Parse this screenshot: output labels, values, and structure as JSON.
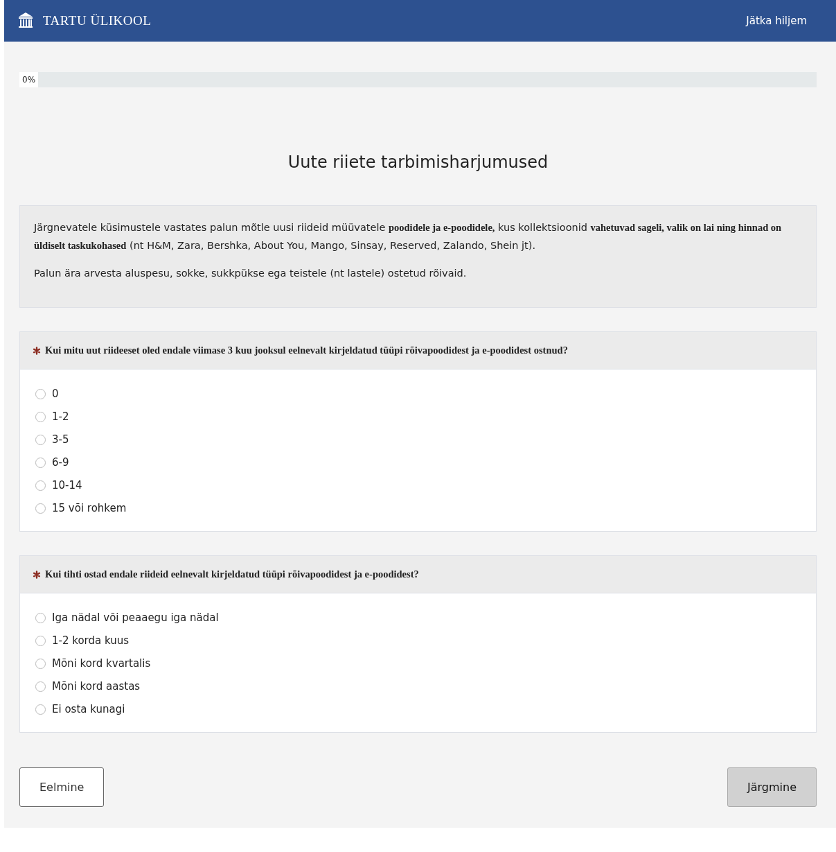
{
  "header": {
    "logo_text": "TARTU ÜLIKOOL",
    "link": "Jätka hiljem"
  },
  "progress": {
    "label": "0%",
    "level": 0
  },
  "title": "Uute riiete tarbimisharjumused",
  "intro": [
    "Järgnevatele küsimustele vastates palun mõtle uusi riideid müüvatele **poodidele ja e-poodidele,** kus kollektsioonid **vahetuvad sageli, valik on lai ning hinnad on üldiselt taskukohased** (nt H&M, Zara, Bershka, About You, Mango, Sinsay, Reserved, Zalando, Shein jt).",
    "Palun ära arvesta aluspesu, sokke, sukkpükse ega teistele (nt lastele) ostetud rõivaid."
  ],
  "questions": [
    {
      "required": true,
      "text": "Kui mitu uut riideeset oled endale viimase 3 kuu jooksul eelnevalt kirjeldatud tüüpi rõivapoodidest ja e-poodidest ostnud?",
      "options": [
        {
          "label": "0",
          "selected": false
        },
        {
          "label": "1-2",
          "selected": false
        },
        {
          "label": "3-5",
          "selected": false
        },
        {
          "label": "6-9",
          "selected": false
        },
        {
          "label": "10-14",
          "selected": false
        },
        {
          "label": "15 või rohkem",
          "selected": false
        }
      ]
    },
    {
      "required": true,
      "text": "Kui tihti ostad endale riideid eelnevalt kirjeldatud tüüpi rõivapoodidest ja e-poodidest?",
      "options": [
        {
          "label": "Iga nädal või peaaegu iga nädal",
          "selected": false
        },
        {
          "label": "1-2 korda kuus",
          "selected": false
        },
        {
          "label": "Mõni kord kvartalis",
          "selected": false
        },
        {
          "label": "Mõni kord aastas",
          "selected": false
        },
        {
          "label": "Ei osta kunagi",
          "selected": false
        }
      ]
    }
  ],
  "nav": {
    "previous": "Eelmine",
    "next": "Järgmine"
  }
}
